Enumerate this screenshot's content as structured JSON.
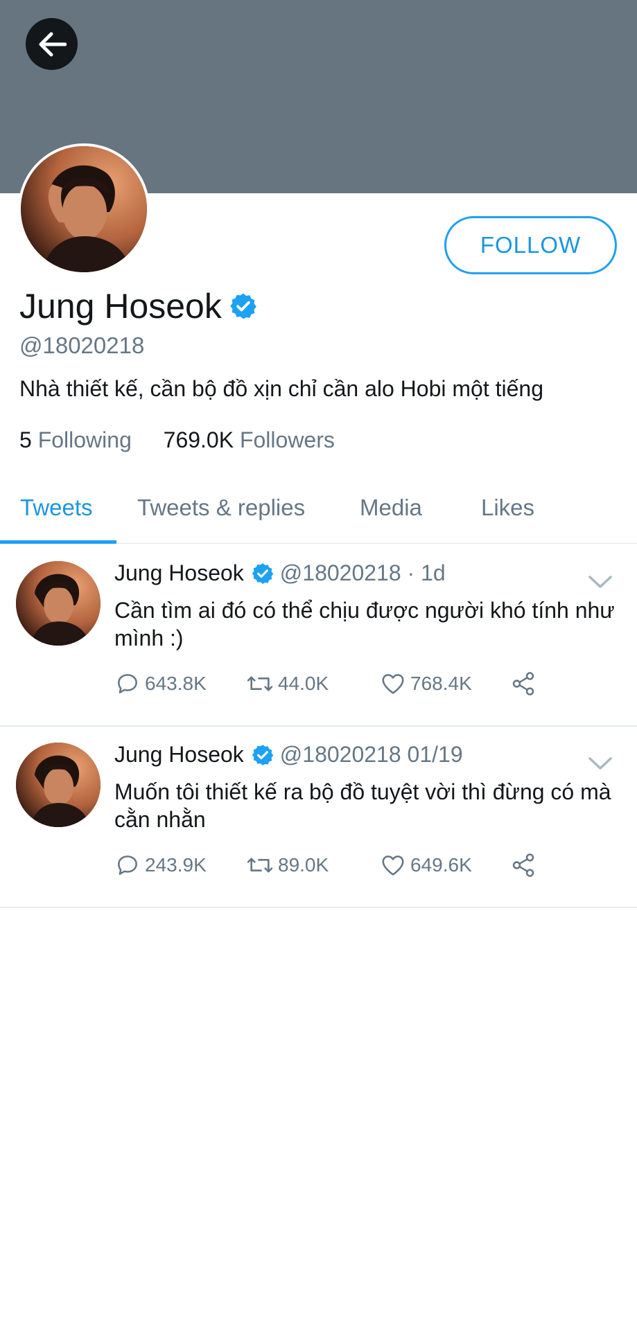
{
  "profile": {
    "name": "Jung Hoseok",
    "handle": "@18020218",
    "bio": "Nhà thiết kế, cần bộ đồ xịn chỉ cần alo Hobi một tiếng",
    "following_count": "5",
    "following_label": "Following",
    "followers_count": "769.0K",
    "followers_label": "Followers",
    "follow_button": "FOLLOW"
  },
  "tabs": [
    {
      "label": "Tweets",
      "active": true
    },
    {
      "label": "Tweets & replies",
      "active": false
    },
    {
      "label": "Media",
      "active": false
    },
    {
      "label": "Likes",
      "active": false
    }
  ],
  "tweets": [
    {
      "name": "Jung Hoseok",
      "meta": "@18020218 · 1d",
      "text": "Cần tìm ai đó có thể chịu được người khó tính như mình :)",
      "replies": "643.8K",
      "retweets": "44.0K",
      "likes": "768.4K"
    },
    {
      "name": "Jung Hoseok",
      "meta": "@18020218 01/19",
      "text": "Muốn tôi thiết kế ra bộ đồ tuyệt vời thì đừng có mà cằn nhằn",
      "replies": "243.9K",
      "retweets": "89.0K",
      "likes": "649.6K"
    }
  ],
  "colors": {
    "banner": "#66757f",
    "accent": "#1da1f2",
    "secondary_text": "#657786"
  },
  "icons": [
    "back-arrow-icon",
    "verified-badge-icon",
    "chevron-down-icon",
    "reply-icon",
    "retweet-icon",
    "like-icon",
    "share-icon"
  ]
}
